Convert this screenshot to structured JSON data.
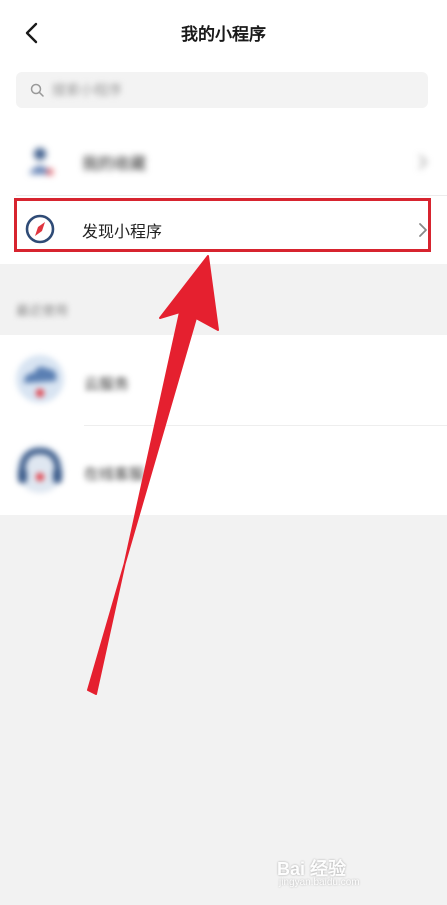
{
  "header": {
    "title": "我的小程序"
  },
  "search": {
    "placeholder": "搜索小程序"
  },
  "list_top": [
    {
      "label": "我的收藏",
      "icon": "user-mini-program-icon"
    },
    {
      "label": "发现小程序",
      "icon": "compass-icon"
    }
  ],
  "section": {
    "label": "最近使用"
  },
  "recent": [
    {
      "label": "云服务",
      "icon": "cloud-app-icon"
    },
    {
      "label": "在线客服",
      "icon": "headset-app-icon"
    }
  ],
  "watermark": {
    "text": "Bai 经验",
    "sub": "jingyan.baidu.com"
  },
  "colors": {
    "highlight": "#d7242f",
    "arrow": "#e5202f",
    "accent": "#3b5b8a"
  }
}
